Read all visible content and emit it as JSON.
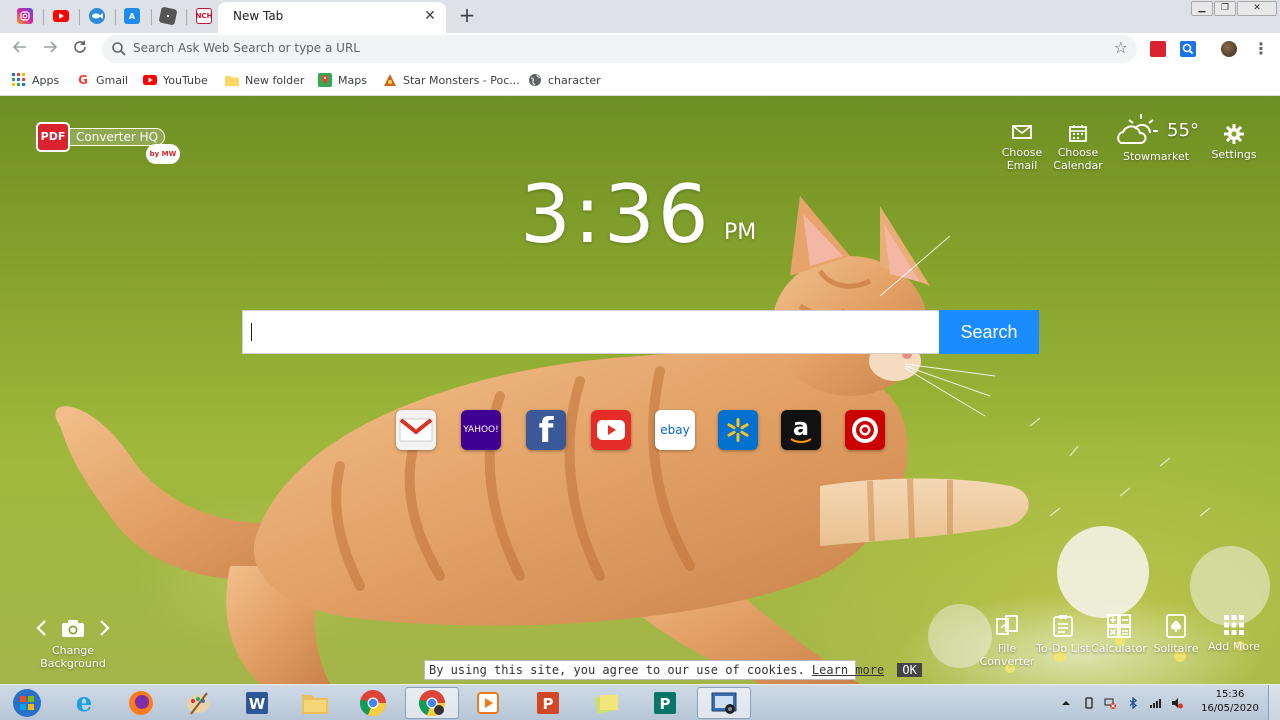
{
  "browser": {
    "active_tab_title": "New Tab",
    "new_tab_glyph": "+",
    "close_tab_glyph": "✕",
    "pinned_tabs": [
      {
        "name": "instagram-icon",
        "color": "#d6249f"
      },
      {
        "name": "youtube-icon",
        "color": "#ff0000"
      },
      {
        "name": "fish-icon",
        "color": "#2d8cd6"
      },
      {
        "name": "app-store-icon",
        "color": "#1f8ceb"
      },
      {
        "name": "roblox-icon",
        "color": "#555555"
      },
      {
        "name": "nch-icon",
        "color": "#c8102e",
        "text": "NCH"
      }
    ],
    "omnibox_placeholder": "Search Ask Web Search or type a URL",
    "bookmarks": [
      {
        "label": "Apps",
        "icon": "apps-grid-icon"
      },
      {
        "label": "Gmail",
        "icon": "google-icon"
      },
      {
        "label": "YouTube",
        "icon": "youtube-icon"
      },
      {
        "label": "New folder",
        "icon": "folder-icon"
      },
      {
        "label": "Maps",
        "icon": "maps-icon"
      },
      {
        "label": "Star Monsters - Poc...",
        "icon": "star-monsters-icon"
      },
      {
        "label": "character",
        "icon": "globe-icon"
      }
    ]
  },
  "newtab": {
    "logo": {
      "pdf": "PDF",
      "name": "Converter HQ",
      "by": "by MW"
    },
    "clock": {
      "time": "3:36",
      "period": "PM"
    },
    "top_tools": [
      {
        "label": "Choose Email",
        "icon": "envelope-icon"
      },
      {
        "label": "Choose Calendar",
        "icon": "calendar-icon"
      },
      {
        "label": "Stowmarket",
        "icon": "partly-cloudy-icon",
        "temp": "55°"
      },
      {
        "label": "Settings",
        "icon": "gear-icon"
      }
    ],
    "search": {
      "button": "Search"
    },
    "quick_links": [
      {
        "name": "gmail-link",
        "text": "",
        "bg": "#f2f2f2"
      },
      {
        "name": "yahoo-link",
        "text": "YAHOO!",
        "bg": "#410093"
      },
      {
        "name": "facebook-link",
        "text": "f",
        "bg": "#3b5998"
      },
      {
        "name": "youtube-link",
        "text": "",
        "bg": "#e52d27"
      },
      {
        "name": "ebay-link",
        "text": "ebay",
        "bg": "#ffffff"
      },
      {
        "name": "walmart-link",
        "text": "",
        "bg": "#0071ce"
      },
      {
        "name": "amazon-link",
        "text": "a",
        "bg": "#111111"
      },
      {
        "name": "target-link",
        "text": "",
        "bg": "#cc0000"
      }
    ],
    "background": {
      "label": "Change Background"
    },
    "bottom_tools": [
      {
        "label": "File Converter",
        "icon": "file-converter-icon"
      },
      {
        "label": "To-Do List",
        "icon": "todo-list-icon"
      },
      {
        "label": "Calculator",
        "icon": "calculator-icon"
      },
      {
        "label": "Solitaire",
        "icon": "solitaire-icon"
      },
      {
        "label": "Add More",
        "icon": "grid-icon"
      }
    ],
    "cookie": {
      "text": "By using this site, you agree to our use of cookies.",
      "learn": "Learn more",
      "ok": "OK"
    }
  },
  "taskbar": {
    "apps": [
      {
        "name": "start-button",
        "color": "#2a70c8"
      },
      {
        "name": "internet-explorer",
        "color": "#1ea0e6"
      },
      {
        "name": "firefox",
        "color": "#ff7a1a"
      },
      {
        "name": "paint",
        "color": "#d9a046"
      },
      {
        "name": "word",
        "color": "#2b5797"
      },
      {
        "name": "file-explorer",
        "color": "#e8c15a"
      },
      {
        "name": "chrome",
        "color": "#34a853"
      },
      {
        "name": "chrome-active",
        "color": "#4285f4"
      },
      {
        "name": "media-player",
        "color": "#f07a1a"
      },
      {
        "name": "powerpoint",
        "color": "#d24726"
      },
      {
        "name": "sticky-notes",
        "color": "#c9e36a"
      },
      {
        "name": "publisher",
        "color": "#077568"
      },
      {
        "name": "recorder",
        "color": "#3a6fb0"
      }
    ],
    "time": "15:36",
    "date": "16/05/2020"
  }
}
